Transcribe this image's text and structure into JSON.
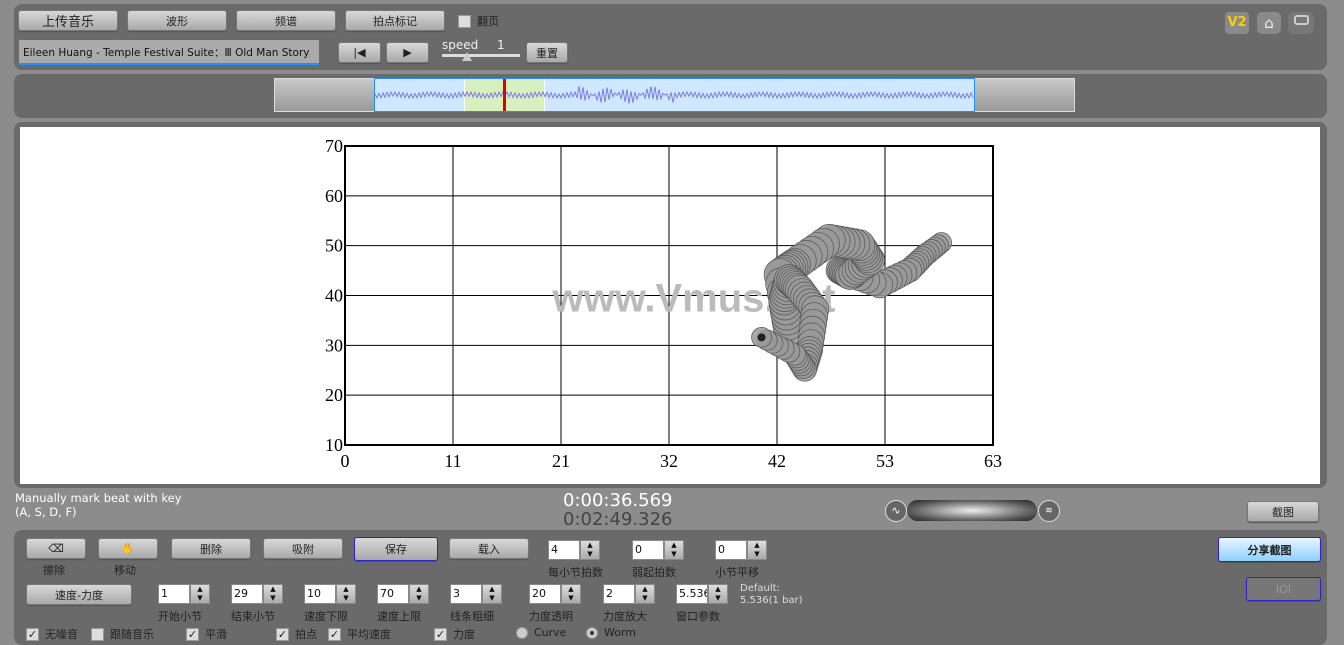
{
  "toolbar": {
    "upload": "上传音乐",
    "waveform": "波形",
    "spectrum": "频谱",
    "beat_mark": "拍点标记",
    "page_flip": "翻页",
    "song": "Eileen Huang - Temple Festival Suite：Ⅲ Old Man Story",
    "speed_label": "speed",
    "speed_value": "1",
    "reset": "重置"
  },
  "top_icons": {
    "v2": "V2",
    "home": "home-icon",
    "screen": "fullscreen-icon"
  },
  "status": {
    "hint_line1": "Manually mark beat with key",
    "hint_line2": "(A, S, D, F)",
    "current_time": "0:00:36.569",
    "total_time": "0:02:49.326",
    "screenshot": "截图"
  },
  "tools": {
    "erase": "擦除",
    "move": "移动",
    "delete": "删除",
    "snap": "吸附",
    "save": "保存",
    "load": "载入",
    "speed_dynamics": "速度-力度",
    "share": "分享截图",
    "ioi": "IOI"
  },
  "spinners": [
    {
      "label": "每小节拍数",
      "value": "4"
    },
    {
      "label": "弱起拍数",
      "value": "0"
    },
    {
      "label": "小节平移",
      "value": "0"
    },
    {
      "label": "开始小节",
      "value": "1"
    },
    {
      "label": "结束小节",
      "value": "29"
    },
    {
      "label": "速度下限",
      "value": "10"
    },
    {
      "label": "速度上限",
      "value": "70"
    },
    {
      "label": "线条粗细",
      "value": "3"
    },
    {
      "label": "力度透明",
      "value": "20"
    },
    {
      "label": "力度放大",
      "value": "2"
    },
    {
      "label": "窗口参数",
      "value": "5.5363"
    }
  ],
  "default_note": {
    "line1": "Default:",
    "line2": "5.536(1 bar)"
  },
  "checks": [
    {
      "label": "无噪音",
      "checked": true
    },
    {
      "label": "跟随音乐",
      "checked": false
    },
    {
      "label": "平滑",
      "checked": true
    },
    {
      "label": "拍点",
      "checked": true
    },
    {
      "label": "平均速度",
      "checked": true
    },
    {
      "label": "力度",
      "checked": true
    }
  ],
  "modes": [
    {
      "label": "Curve",
      "selected": false
    },
    {
      "label": "Worm",
      "selected": true
    }
  ],
  "watermark": "www.Vmus.net",
  "playhead_fraction": 0.22,
  "chart_data": {
    "type": "line",
    "x_ticks": [
      "0",
      "11",
      "21",
      "32",
      "42",
      "53",
      "63"
    ],
    "y_ticks": [
      "10",
      "20",
      "30",
      "40",
      "50",
      "60",
      "70"
    ],
    "xlim": [
      0,
      63
    ],
    "ylim": [
      10,
      70
    ],
    "grid": true,
    "x": [
      40.5,
      43.7,
      44.7,
      45.2,
      45.7,
      44.2,
      43.2,
      42.7,
      43.2,
      42.3,
      43.7,
      47.1,
      50.0,
      51.0,
      49.1,
      48.1,
      52.0,
      54.9,
      56.4,
      58.3
    ],
    "y": [
      31.6,
      28.2,
      25.2,
      29.2,
      37.2,
      41.2,
      43.2,
      39.2,
      33.2,
      44.2,
      46.2,
      51.1,
      50.1,
      47.1,
      44.1,
      45.1,
      42.1,
      45.1,
      48.1,
      51.1
    ]
  },
  "colors": {
    "accent": "#1e90ff",
    "waveform": "#8080e0",
    "selection": "#d8f0c0",
    "playhead": "#e00000"
  }
}
